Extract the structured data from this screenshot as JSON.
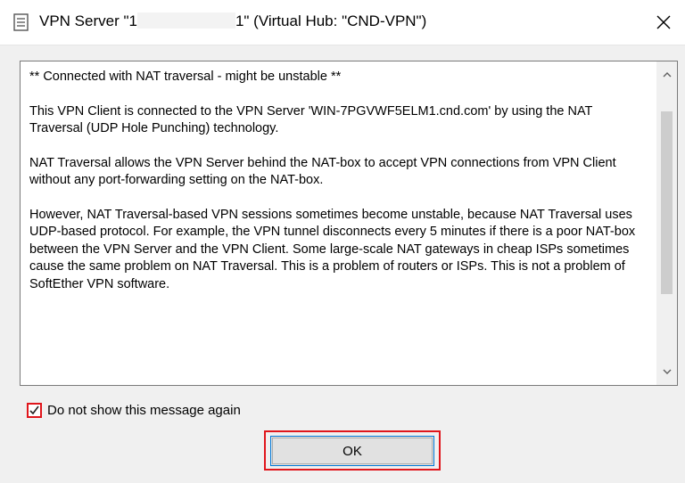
{
  "window": {
    "title_prefix": "VPN Server \"1",
    "title_suffix": "1\" (Virtual Hub: \"CND-VPN\")",
    "close_glyph": "✕",
    "icon": "document-icon"
  },
  "message": {
    "paragraphs": [
      "** Connected with NAT traversal - might be unstable **",
      "This VPN Client is connected to the VPN Server 'WIN-7PGVWF5ELM1.cnd.com' by using the NAT Traversal (UDP Hole Punching) technology.",
      "NAT Traversal allows the VPN Server behind the NAT-box to accept VPN connections from VPN Client without any port-forwarding setting on the NAT-box.",
      "However, NAT Traversal-based VPN sessions sometimes become unstable, because NAT Traversal uses UDP-based protocol. For example, the VPN tunnel disconnects every 5 minutes if there is a poor NAT-box between the VPN Server and the VPN Client. Some large-scale NAT gateways in cheap ISPs sometimes cause the same problem on NAT Traversal. This is a problem of routers or ISPs. This is not a problem of SoftEther VPN software."
    ],
    "scroll_up_glyph": "^",
    "scroll_down_glyph": "v"
  },
  "checkbox": {
    "label": "Do not show this message again",
    "checked": true
  },
  "buttons": {
    "ok_label": "OK"
  },
  "colors": {
    "highlight": "#e0161c",
    "focus_border": "#0078d7"
  }
}
